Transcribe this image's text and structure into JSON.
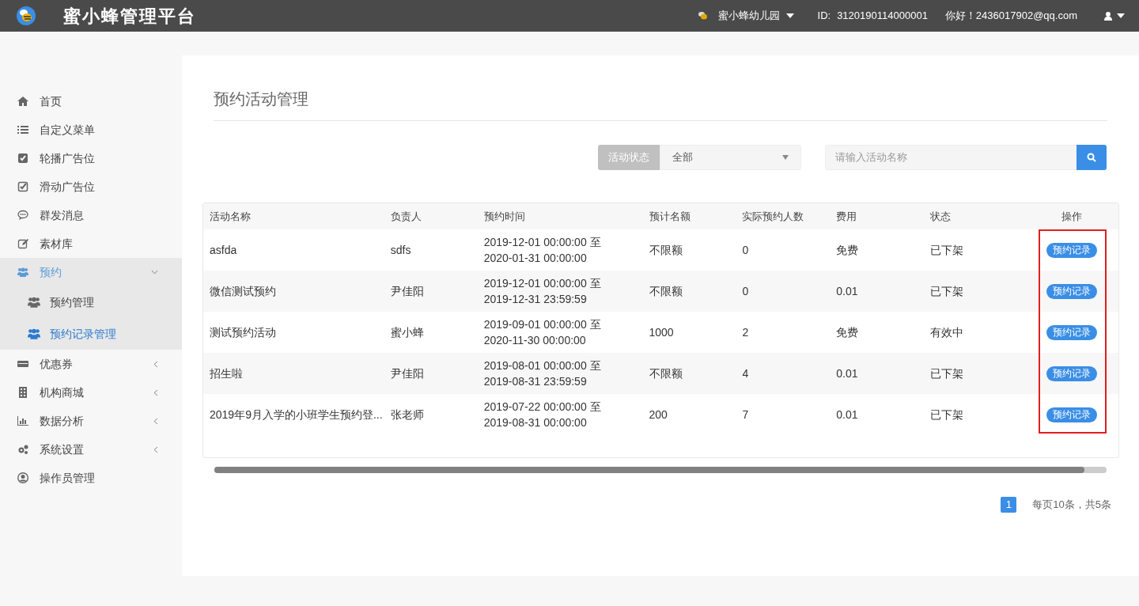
{
  "header": {
    "title": "蜜小蜂管理平台",
    "org": "蜜小蜂幼儿园",
    "id_label": "ID:",
    "id_value": "3120190114000001",
    "greeting": "你好！2436017902@qq.com"
  },
  "sidebar": {
    "items": [
      {
        "label": "首页",
        "selected": false
      },
      {
        "label": "自定义菜单",
        "selected": false
      },
      {
        "label": "轮播广告位",
        "selected": false
      },
      {
        "label": "滑动广告位",
        "selected": false
      },
      {
        "label": "群发消息",
        "selected": false
      },
      {
        "label": "素材库",
        "selected": false
      },
      {
        "label": "预约",
        "selected": true,
        "expanded": true,
        "children": [
          {
            "label": "预约管理",
            "selected": false
          },
          {
            "label": "预约记录管理",
            "selected": true
          }
        ]
      },
      {
        "label": "优惠券",
        "selected": false,
        "expanded": false
      },
      {
        "label": "机构商城",
        "selected": false,
        "expanded": false
      },
      {
        "label": "数据分析",
        "selected": false,
        "expanded": false
      },
      {
        "label": "系统设置",
        "selected": false,
        "expanded": false
      },
      {
        "label": "操作员管理",
        "selected": false
      }
    ]
  },
  "page": {
    "title": "预约活动管理",
    "filter": {
      "label": "活动状态",
      "value": "全部"
    },
    "search": {
      "placeholder": "请输入活动名称"
    },
    "table": {
      "columns": [
        "活动名称",
        "负责人",
        "预约时间",
        "预计名额",
        "实际预约人数",
        "费用",
        "状态",
        "操作"
      ],
      "rows": [
        {
          "cells": [
            "asfda",
            "sdfs",
            "2019-12-01 00:00:00 至 2020-01-31 00:00:00",
            "不限额",
            "0",
            "免费",
            "已下架",
            "预约记录"
          ]
        },
        {
          "cells": [
            "微信测试预约",
            "尹佳阳",
            "2019-12-01 00:00:00 至 2019-12-31 23:59:59",
            "不限额",
            "0",
            "0.01",
            "已下架",
            "预约记录"
          ]
        },
        {
          "cells": [
            "测试预约活动",
            "蜜小蜂",
            "2019-09-01 00:00:00 至 2020-11-30 00:00:00",
            "1000",
            "2",
            "免费",
            "有效中",
            "预约记录"
          ]
        },
        {
          "cells": [
            "招生啦",
            "尹佳阳",
            "2019-08-01 00:00:00 至 2019-08-31 23:59:59",
            "不限额",
            "4",
            "0.01",
            "已下架",
            "预约记录"
          ]
        },
        {
          "cells": [
            "2019年9月入学的小班学生预约登...",
            "张老师",
            "2019-07-22 00:00:00 至 2019-08-31 00:00:00",
            "200",
            "7",
            "0.01",
            "已下架",
            "预约记录"
          ]
        }
      ]
    },
    "pagination": {
      "pages": [
        {
          "label": "1",
          "selected": true
        }
      ],
      "summary": "每页10条，共5条"
    }
  }
}
